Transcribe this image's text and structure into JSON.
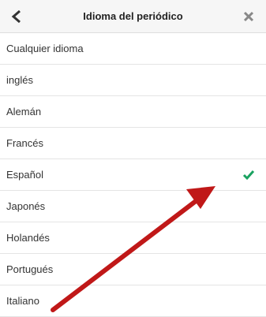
{
  "header": {
    "title": "Idioma del periódico",
    "back_icon": "chevron-left-icon",
    "close_icon": "close-icon"
  },
  "languages": [
    {
      "label": "Cualquier idioma",
      "selected": false
    },
    {
      "label": "inglés",
      "selected": false
    },
    {
      "label": "Alemán",
      "selected": false
    },
    {
      "label": "Francés",
      "selected": false
    },
    {
      "label": "Español",
      "selected": true
    },
    {
      "label": "Japonés",
      "selected": false
    },
    {
      "label": "Holandés",
      "selected": false
    },
    {
      "label": "Portugués",
      "selected": false
    },
    {
      "label": "Italiano",
      "selected": false
    }
  ],
  "colors": {
    "check": "#1aa260",
    "annotation_arrow": "#c01818"
  }
}
